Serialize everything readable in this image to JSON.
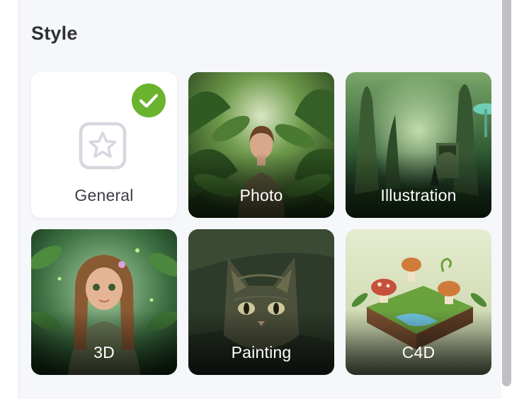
{
  "section": {
    "title": "Style"
  },
  "styles": [
    {
      "label": "General",
      "selected": true
    },
    {
      "label": "Photo",
      "selected": false
    },
    {
      "label": "Illustration",
      "selected": false
    },
    {
      "label": "3D",
      "selected": false
    },
    {
      "label": "Painting",
      "selected": false
    },
    {
      "label": "C4D",
      "selected": false
    }
  ],
  "icons": {
    "selected": "checkmark-icon",
    "general": "star-icon"
  },
  "colors": {
    "selected_badge": "#6ab32e",
    "panel_background": "#f6f7fb"
  }
}
